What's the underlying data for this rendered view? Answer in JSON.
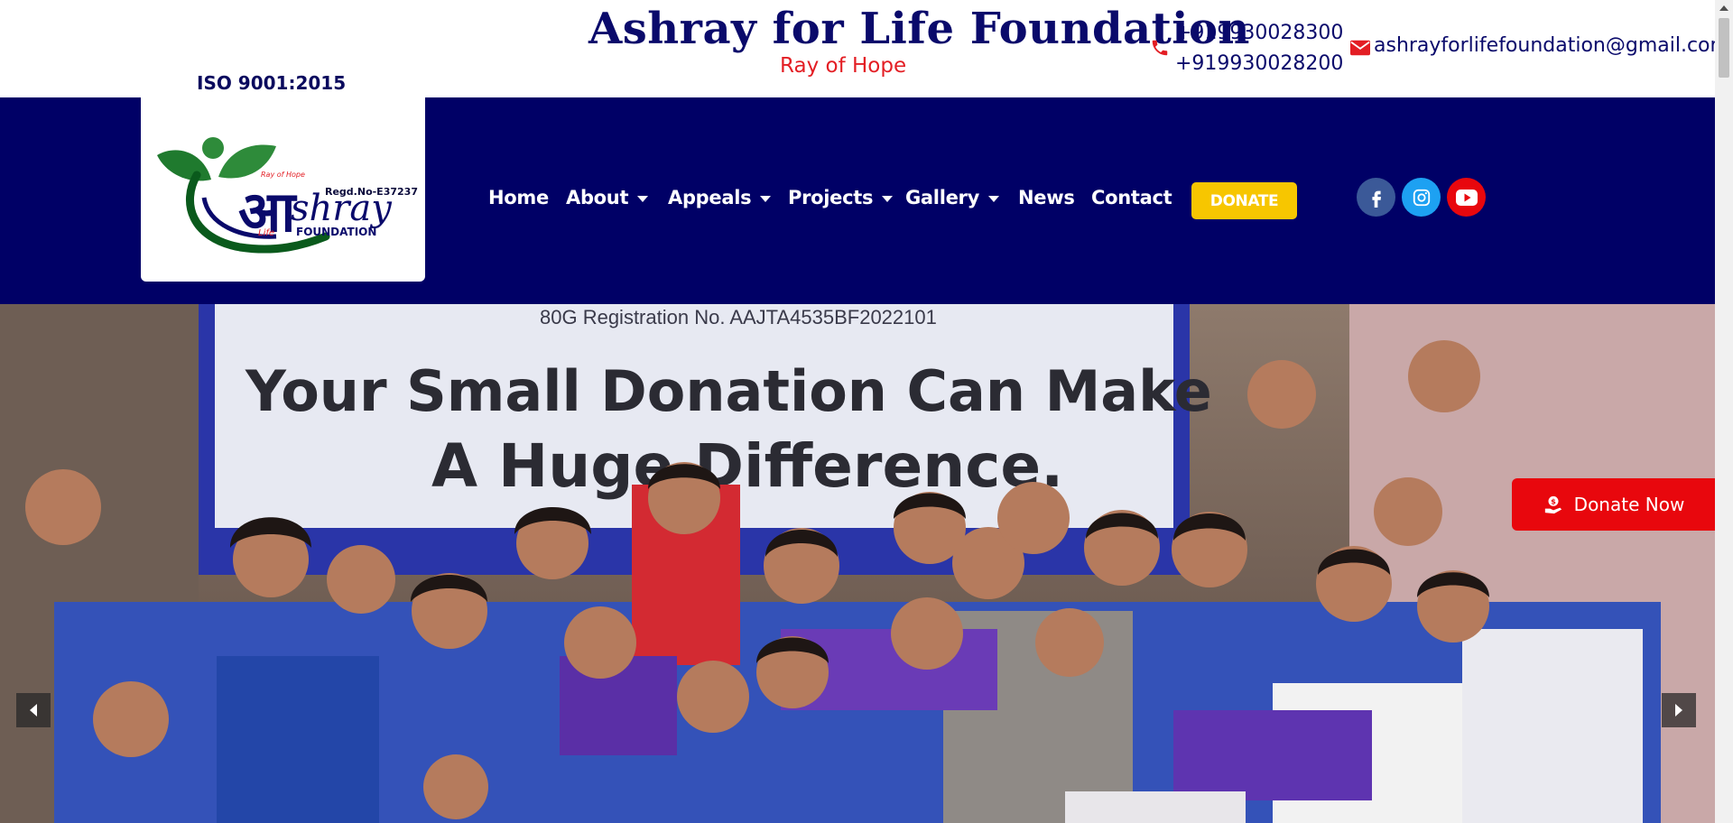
{
  "header": {
    "certification": "ISO 9001:2015",
    "title": "Ashray for Life Foundation",
    "tagline": "Ray of Hope",
    "phones": [
      "+919930028300",
      "+919930028200"
    ],
    "email": "ashrayforlifefoundation@gmail.com"
  },
  "logo": {
    "small_text": "Ray of Hope",
    "regd": "Regd.No-E37237",
    "devanagari": "आ",
    "word": "shray",
    "life": "Life",
    "foundation": "FOUNDATION"
  },
  "nav": {
    "items": [
      {
        "label": "Home",
        "dropdown": false
      },
      {
        "label": "About",
        "dropdown": true
      },
      {
        "label": "Appeals",
        "dropdown": true
      },
      {
        "label": "Projects",
        "dropdown": true
      },
      {
        "label": "Gallery",
        "dropdown": true
      },
      {
        "label": "News",
        "dropdown": false
      },
      {
        "label": "Contact",
        "dropdown": false
      }
    ],
    "donate_label": "DONATE"
  },
  "social": [
    {
      "name": "facebook-icon",
      "color": "#3b5998"
    },
    {
      "name": "instagram-icon",
      "color": "#1da1f2"
    },
    {
      "name": "youtube-icon",
      "color": "#e8070d"
    }
  ],
  "hero": {
    "banner_line_small": "80G Registration No. AAJTA4535BF2022101",
    "banner_line_1": "Your Small Donation Can Make",
    "banner_line_2": "A Huge Difference.",
    "donate_now_label": "Donate Now"
  },
  "colors": {
    "navy": "#000066",
    "title_navy": "#0a0a6b",
    "red": "#e31e24",
    "donate_yellow": "#f7c600",
    "donate_now_red": "#e8070d"
  }
}
